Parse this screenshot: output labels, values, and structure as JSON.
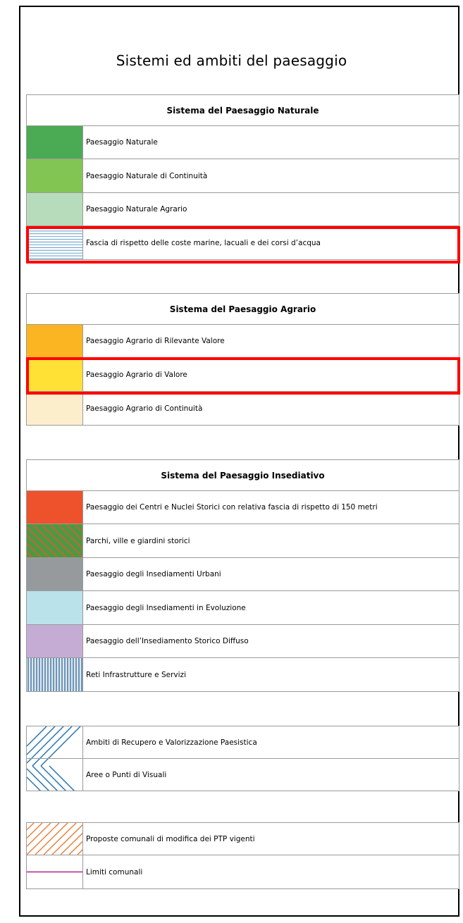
{
  "title": "Sistemi ed ambiti del paesaggio",
  "colors": {
    "highlight": "#ff0000",
    "natural": "#4bab55",
    "natural_continuity": "#82c555",
    "natural_agrarian": "#b7dcbb",
    "water_band_lines": "#5b9cc9",
    "agrarian_relevant": "#fbb522",
    "agrarian_value": "#ffe135",
    "agrarian_continuity": "#fdeecb",
    "historic_centers": "#ee522c",
    "parks_green": "#4a9a45",
    "parks_hatch": "#e05a2a",
    "urban": "#969a9d",
    "evolution": "#b9e2ea",
    "diffuse_historic": "#c5acd4",
    "infrastructure_lines": "#2a5a8a",
    "recovery_lines": "#2774b0",
    "proposals_lines": "#e8833b",
    "municipal_limit": "#b0228a"
  },
  "sections": {
    "natural": {
      "header": "Sistema del Paesaggio Naturale",
      "rows": [
        {
          "label": "Paesaggio Naturale",
          "icon": "solid-green-swatch"
        },
        {
          "label": "Paesaggio Naturale di Continuità",
          "icon": "solid-light-green-swatch"
        },
        {
          "label": "Paesaggio Naturale Agrario",
          "icon": "solid-pale-green-swatch"
        },
        {
          "label": "Fascia di rispetto delle coste marine, lacuali e dei corsi d’acqua",
          "icon": "horizontal-blue-lines-swatch",
          "highlighted": true
        }
      ]
    },
    "agrarian": {
      "header": "Sistema del Paesaggio Agrario",
      "rows": [
        {
          "label": "Paesaggio Agrario di Rilevante Valore",
          "icon": "solid-orange-swatch"
        },
        {
          "label": "Paesaggio Agrario di Valore",
          "icon": "solid-yellow-swatch",
          "highlighted": true
        },
        {
          "label": "Paesaggio Agrario di Continuità",
          "icon": "solid-cream-swatch"
        }
      ]
    },
    "settlement": {
      "header": "Sistema del Paesaggio Insediativo",
      "rows": [
        {
          "label": "Paesaggio dei Centri e Nuclei Storici con relativa fascia di rispetto di 150 metri",
          "icon": "solid-red-orange-swatch"
        },
        {
          "label": "Parchi, ville e giardini storici",
          "icon": "green-orange-hatch-swatch"
        },
        {
          "label": "Paesaggio degli Insediamenti Urbani",
          "icon": "solid-grey-swatch"
        },
        {
          "label": "Paesaggio degli Insediamenti in Evoluzione",
          "icon": "solid-light-blue-swatch"
        },
        {
          "label": "Paesaggio dell’Insediamento Storico Diffuso",
          "icon": "solid-lilac-swatch"
        },
        {
          "label": "Reti Infrastrutture e Servizi",
          "icon": "vertical-blue-lines-swatch"
        }
      ]
    },
    "areas": {
      "rows": [
        {
          "label": "Ambiti di Recupero e Valorizzazione Paesistica",
          "icon": "blue-diagonal-hatch-swatch"
        },
        {
          "label": "Aree o Punti di Visuali",
          "icon": "blue-reverse-diagonal-hatch-swatch"
        }
      ]
    },
    "other": {
      "rows": [
        {
          "label": "Proposte comunali di modifica dei PTP vigenti",
          "icon": "orange-diagonal-hatch-swatch"
        },
        {
          "label": "Limiti comunali",
          "icon": "purple-line-swatch"
        }
      ]
    }
  }
}
